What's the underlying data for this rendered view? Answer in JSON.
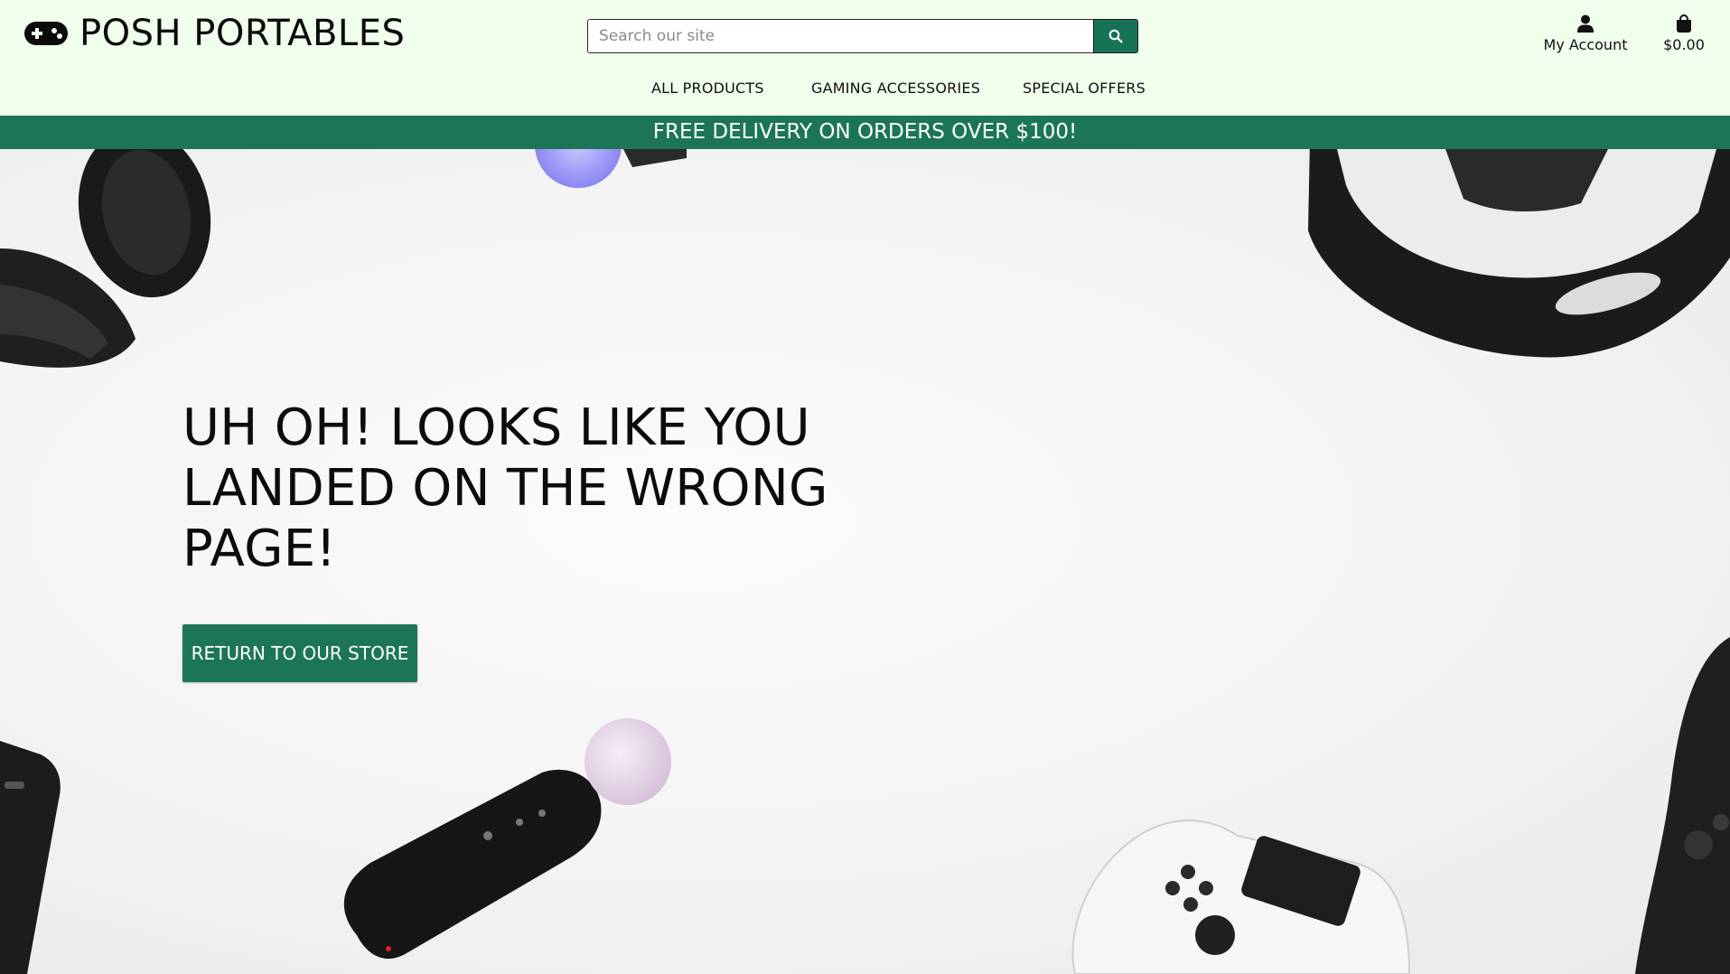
{
  "brand": {
    "name": "POSH PORTABLES",
    "icon": "gamepad-icon"
  },
  "search": {
    "placeholder": "Search our site",
    "value": "",
    "button_icon": "search-icon"
  },
  "account": {
    "label": "My Account",
    "icon": "user-icon"
  },
  "cart": {
    "total": "$0.00",
    "icon": "shopping-bag-icon"
  },
  "nav": {
    "items": [
      "ALL PRODUCTS",
      "GAMING ACCESSORIES",
      "SPECIAL OFFERS"
    ]
  },
  "banner": {
    "text": "FREE DELIVERY ON ORDERS OVER $100!"
  },
  "hero": {
    "headline": "UH OH! LOOKS LIKE YOU LANDED ON THE WRONG PAGE!",
    "cta_label": "RETURN TO OUR STORE"
  },
  "colors": {
    "header_bg": "#efffec",
    "accent": "#1c7656",
    "text": "#111111"
  }
}
